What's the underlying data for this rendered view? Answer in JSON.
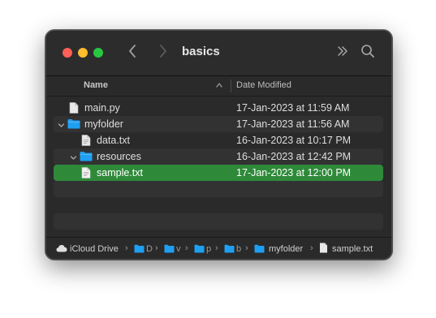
{
  "window": {
    "title": "basics"
  },
  "columns": {
    "name": "Name",
    "date": "Date Modified"
  },
  "files": [
    {
      "name": "main.py",
      "date": "17-Jan-2023 at 11:59 AM",
      "kind": "file"
    },
    {
      "name": "myfolder",
      "date": "17-Jan-2023 at 11:56 AM",
      "kind": "folder",
      "expanded": true
    },
    {
      "name": "data.txt",
      "date": "16-Jan-2023 at 10:17 PM",
      "kind": "file"
    },
    {
      "name": "resources",
      "date": "16-Jan-2023 at 12:42 PM",
      "kind": "folder",
      "expanded": true
    },
    {
      "name": "sample.txt",
      "date": "17-Jan-2023 at 12:00 PM",
      "kind": "file",
      "selected": true
    }
  ],
  "pathbar": {
    "items": [
      "iCloud Drive",
      "D",
      "v",
      "p",
      "b",
      "myfolder",
      "sample.txt"
    ]
  },
  "colors": {
    "selection": "#2e8a39",
    "folder": "#1f9ff2",
    "close": "#fe5f57",
    "minimize": "#febc2e",
    "zoom": "#28c840"
  },
  "icons": {
    "back": "chevron-left-icon",
    "forward": "chevron-right-icon",
    "more": "double-chevron-right-icon",
    "search": "magnifier-icon"
  }
}
